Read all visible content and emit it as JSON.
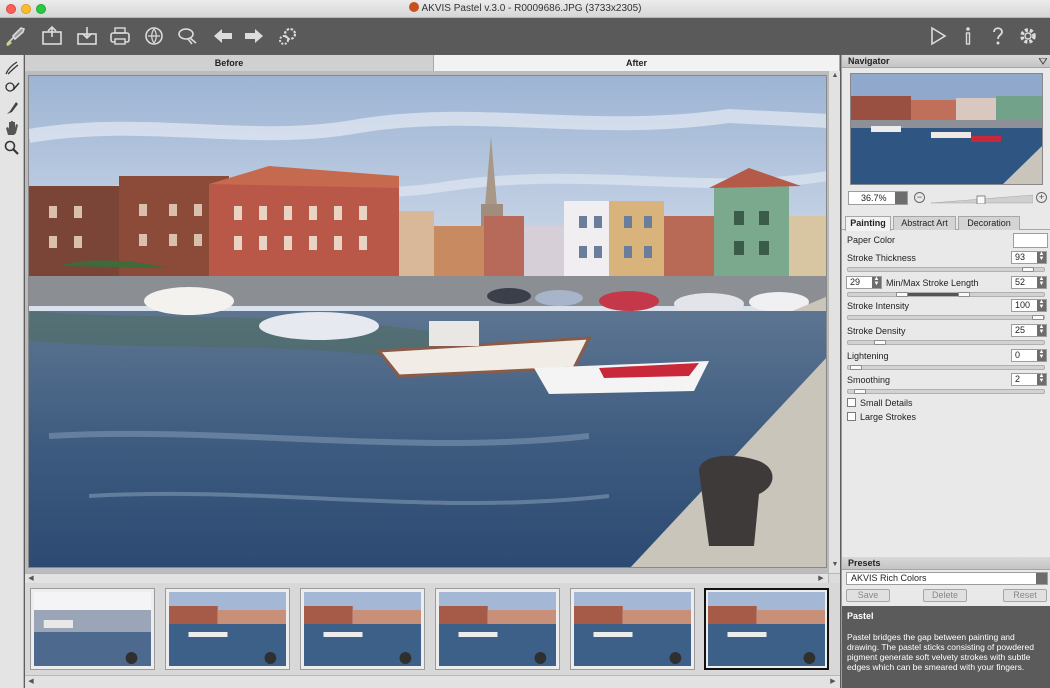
{
  "window": {
    "title": "AKVIS Pastel v.3.0 - R0009686.JPG (3733x2305)"
  },
  "toolbar": {
    "left_icons": [
      "brush-logo-icon",
      "open-icon",
      "save-icon",
      "print-icon",
      "share-icon",
      "batch-icon",
      "undo-icon",
      "redo-icon",
      "plugin-settings-icon"
    ],
    "right_icons": [
      "run-icon",
      "info-icon",
      "help-icon",
      "preferences-icon"
    ]
  },
  "tools": [
    "pastel-brush-icon",
    "stroke-direction-icon",
    "eraser-icon",
    "hand-icon",
    "zoom-icon"
  ],
  "view_tabs": {
    "before": "Before",
    "after": "After"
  },
  "navigator": {
    "title": "Navigator",
    "zoom": "36.7%"
  },
  "settings_tabs": [
    "Painting",
    "Abstract Art",
    "Decoration"
  ],
  "painting": {
    "paper_color_label": "Paper Color",
    "paper_color": "#ffffff",
    "stroke_thickness_label": "Stroke Thickness",
    "stroke_thickness": "93",
    "min_stroke_length": "29",
    "stroke_length_label": "Min/Max Stroke Length",
    "max_stroke_length": "52",
    "stroke_intensity_label": "Stroke Intensity",
    "stroke_intensity": "100",
    "stroke_density_label": "Stroke Density",
    "stroke_density": "25",
    "lightening_label": "Lightening",
    "lightening": "0",
    "smoothing_label": "Smoothing",
    "smoothing": "2",
    "small_details_label": "Small Details",
    "large_strokes_label": "Large Strokes"
  },
  "presets": {
    "title": "Presets",
    "selected": "AKVIS Rich Colors",
    "save_label": "Save",
    "delete_label": "Delete",
    "reset_label": "Reset"
  },
  "description": {
    "title": "Pastel",
    "text": "Pastel bridges the gap between painting and drawing. The pastel sticks consisting of powdered pigment generate soft velvety strokes with subtle edges which can be smeared with your fingers."
  },
  "colors": {
    "toolbar_bg": "#5a5a5a",
    "panel_bg": "#e9e9e9",
    "description_bg": "#5b5b5b"
  }
}
